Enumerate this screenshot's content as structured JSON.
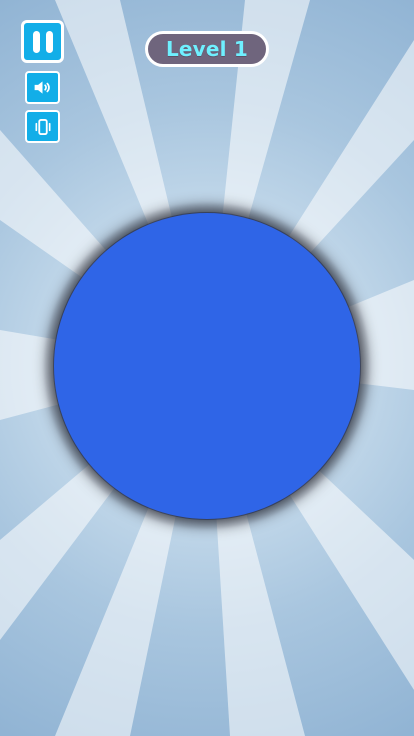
{
  "hud": {
    "level_label": "Level 1"
  },
  "controls": {
    "pause_icon": "pause-icon",
    "sound_icon": "speaker-icon",
    "vibration_icon": "vibration-icon"
  },
  "play_area": {
    "target_shape": "circle"
  },
  "colors": {
    "background_center": "#dbe9f4",
    "background_edge": "#88acd0",
    "button_fill": "#12aee8",
    "button_border": "#ffffff",
    "level_badge_fill": "#6f657d",
    "level_text": "#6ff0ff",
    "target_fill": "#2f65e7",
    "target_shadow": "#1a1d25"
  }
}
